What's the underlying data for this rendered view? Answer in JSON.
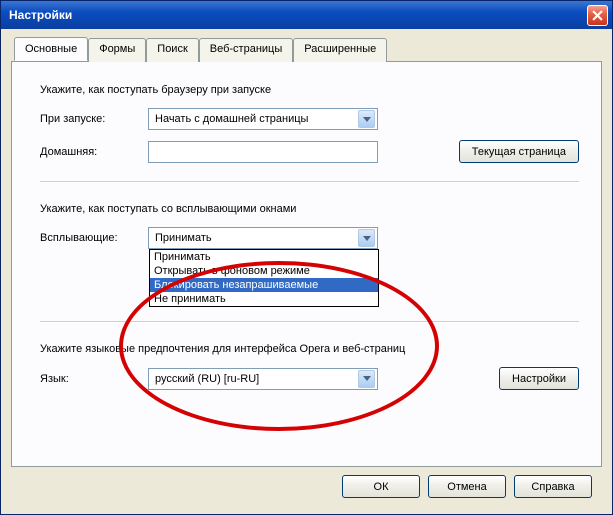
{
  "window": {
    "title": "Настройки",
    "close_icon": "close"
  },
  "tabs": [
    {
      "label": "Основные",
      "active": true
    },
    {
      "label": "Формы",
      "active": false
    },
    {
      "label": "Поиск",
      "active": false
    },
    {
      "label": "Веб-страницы",
      "active": false
    },
    {
      "label": "Расширенные",
      "active": false
    }
  ],
  "startup": {
    "heading": "Укажите, как поступать браузеру при запуске",
    "on_start_label": "При запуске:",
    "on_start_value": "Начать с домашней страницы",
    "home_label": "Домашняя:",
    "home_value": "",
    "current_page_button": "Текущая страница"
  },
  "popups": {
    "heading": "Укажите, как поступать со всплывающими окнами",
    "label": "Всплывающие:",
    "selected_value": "Принимать",
    "options": [
      "Принимать",
      "Открывать в фоновом режиме",
      "Блокировать незапрашиваемые",
      "Не принимать"
    ],
    "highlighted_index": 2
  },
  "language": {
    "heading": "Укажите языковые предпочтения для интерфейса Opera и веб-страниц",
    "label": "Язык:",
    "value": "русский (RU) [ru-RU]",
    "settings_button": "Настройки"
  },
  "footer": {
    "ok": "ОК",
    "cancel": "Отмена",
    "help": "Справка"
  },
  "annotation": {
    "color": "#d40202"
  }
}
